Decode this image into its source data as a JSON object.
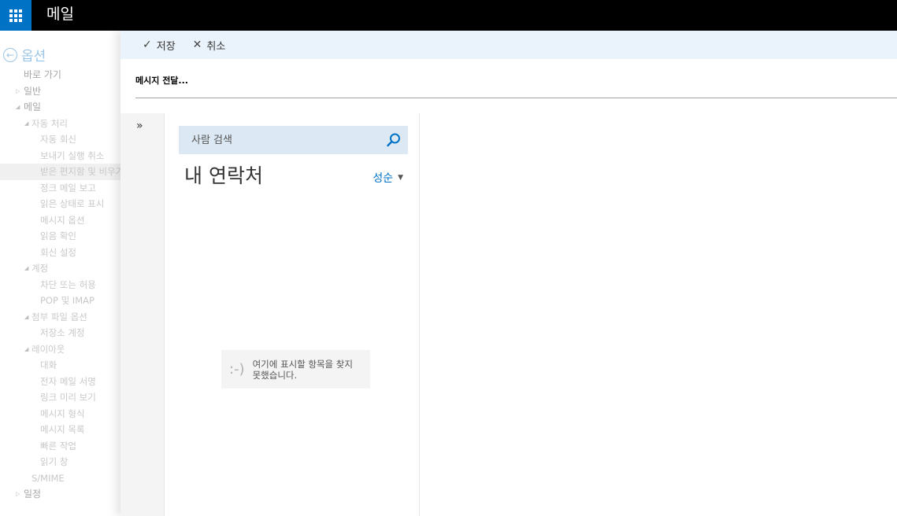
{
  "header": {
    "app_title": "메일",
    "launcher_icon": "waffle-icon"
  },
  "nav": {
    "back_label": "옵션",
    "items": [
      {
        "label": "바로 가기",
        "level": 0,
        "arrow": ""
      },
      {
        "label": "일반",
        "level": 0,
        "arrow": "▷"
      },
      {
        "label": "메일",
        "level": 0,
        "arrow": "◢"
      },
      {
        "label": "자동 처리",
        "level": 1,
        "arrow": "◢"
      },
      {
        "label": "자동 회신",
        "level": 2,
        "arrow": ""
      },
      {
        "label": "보내기 실행 취소",
        "level": 2,
        "arrow": ""
      },
      {
        "label": "받은 편지함 및 비우기 규칙",
        "level": 2,
        "arrow": "",
        "selected": true
      },
      {
        "label": "정크 메일 보고",
        "level": 2,
        "arrow": ""
      },
      {
        "label": "읽은 상태로 표시",
        "level": 2,
        "arrow": ""
      },
      {
        "label": "메시지 옵션",
        "level": 2,
        "arrow": ""
      },
      {
        "label": "읽음 확인",
        "level": 2,
        "arrow": ""
      },
      {
        "label": "회신 설정",
        "level": 2,
        "arrow": ""
      },
      {
        "label": "계정",
        "level": 1,
        "arrow": "◢"
      },
      {
        "label": "차단 또는 허용",
        "level": 2,
        "arrow": ""
      },
      {
        "label": "POP 및 IMAP",
        "level": 2,
        "arrow": ""
      },
      {
        "label": "첨부 파일 옵션",
        "level": 1,
        "arrow": "◢"
      },
      {
        "label": "저장소 계정",
        "level": 2,
        "arrow": ""
      },
      {
        "label": "레이아웃",
        "level": 1,
        "arrow": "◢"
      },
      {
        "label": "대화",
        "level": 2,
        "arrow": ""
      },
      {
        "label": "전자 메일 서명",
        "level": 2,
        "arrow": ""
      },
      {
        "label": "링크 미리 보기",
        "level": 2,
        "arrow": ""
      },
      {
        "label": "메시지 형식",
        "level": 2,
        "arrow": ""
      },
      {
        "label": "메시지 목록",
        "level": 2,
        "arrow": ""
      },
      {
        "label": "빠른 작업",
        "level": 2,
        "arrow": ""
      },
      {
        "label": "읽기 창",
        "level": 2,
        "arrow": ""
      },
      {
        "label": "S/MIME",
        "level": 1,
        "arrow": ""
      },
      {
        "label": "일정",
        "level": 0,
        "arrow": "▷"
      }
    ]
  },
  "toolbar": {
    "save_icon": "✓",
    "save_label": "저장",
    "cancel_icon": "✕",
    "cancel_label": "취소"
  },
  "panel": {
    "section_title": "메시지 전달..."
  },
  "picker": {
    "expand_glyph": "»",
    "search_placeholder": "사람 검색",
    "contacts_title": "내 연락처",
    "sort_label": "성순",
    "sort_caret": "▼",
    "empty_face": ":-)",
    "empty_message": "여기에 표시할 항목을 찾지 못했습니다."
  },
  "colors": {
    "accent": "#0072c6",
    "topbar": "#000000",
    "toolbar_bg": "#eaf3fb",
    "search_bg": "#dce9f5"
  }
}
